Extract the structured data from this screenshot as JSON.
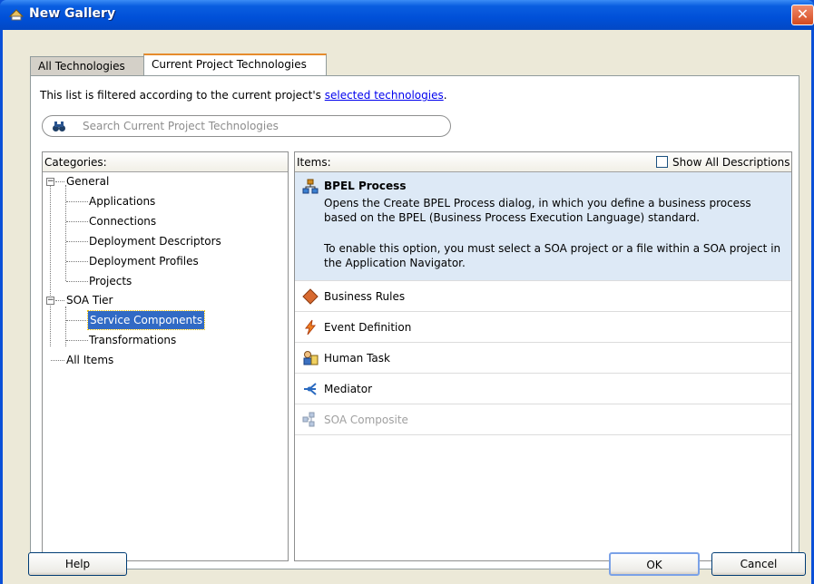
{
  "window": {
    "title": "New Gallery",
    "close_symbol": "✕"
  },
  "tabs": [
    {
      "label": "All Technologies",
      "active": false
    },
    {
      "label": "Current Project Technologies",
      "active": true
    }
  ],
  "filter": {
    "text": "This list is filtered according to the current project's ",
    "link": "selected technologies",
    "suffix": "."
  },
  "search": {
    "placeholder": "Search Current Project Technologies"
  },
  "categories": {
    "header": "Categories:",
    "nodes": [
      {
        "label": "General",
        "level": 0,
        "expandable": true,
        "expanded": true,
        "selected": false
      },
      {
        "label": "Applications",
        "level": 1,
        "selected": false
      },
      {
        "label": "Connections",
        "level": 1,
        "selected": false
      },
      {
        "label": "Deployment Descriptors",
        "level": 1,
        "selected": false
      },
      {
        "label": "Deployment Profiles",
        "level": 1,
        "selected": false
      },
      {
        "label": "Projects",
        "level": 1,
        "selected": false
      },
      {
        "label": "SOA Tier",
        "level": 0,
        "expandable": true,
        "expanded": true,
        "selected": false
      },
      {
        "label": "Service Components",
        "level": 1,
        "selected": true
      },
      {
        "label": "Transformations",
        "level": 1,
        "selected": false
      },
      {
        "label": "All Items",
        "level": 0,
        "selected": false
      }
    ]
  },
  "items": {
    "header": "Items:",
    "show_all_descriptions": {
      "label": "Show All Descriptions",
      "checked": false
    },
    "list": [
      {
        "label": "BPEL Process",
        "icon": "bpel-process-icon",
        "selected": true,
        "description": "Opens the Create BPEL Process dialog, in which you define a business process based on the BPEL (Business Process Execution Language) standard.",
        "note": "To enable this option, you must select a SOA project or a file within a SOA project in the Application Navigator."
      },
      {
        "label": "Business Rules",
        "icon": "business-rules-icon",
        "disabled": false
      },
      {
        "label": "Event Definition",
        "icon": "event-definition-icon",
        "disabled": false
      },
      {
        "label": "Human Task",
        "icon": "human-task-icon",
        "disabled": false
      },
      {
        "label": "Mediator",
        "icon": "mediator-icon",
        "disabled": false
      },
      {
        "label": "SOA Composite",
        "icon": "soa-composite-icon",
        "disabled": true
      }
    ]
  },
  "buttons": {
    "help": "Help",
    "ok": "OK",
    "cancel": "Cancel"
  },
  "colors": {
    "titlebar": "#0050d8",
    "selection": "#316ac5",
    "selected_item_bg": "#dde9f6",
    "link": "#0000ee"
  }
}
